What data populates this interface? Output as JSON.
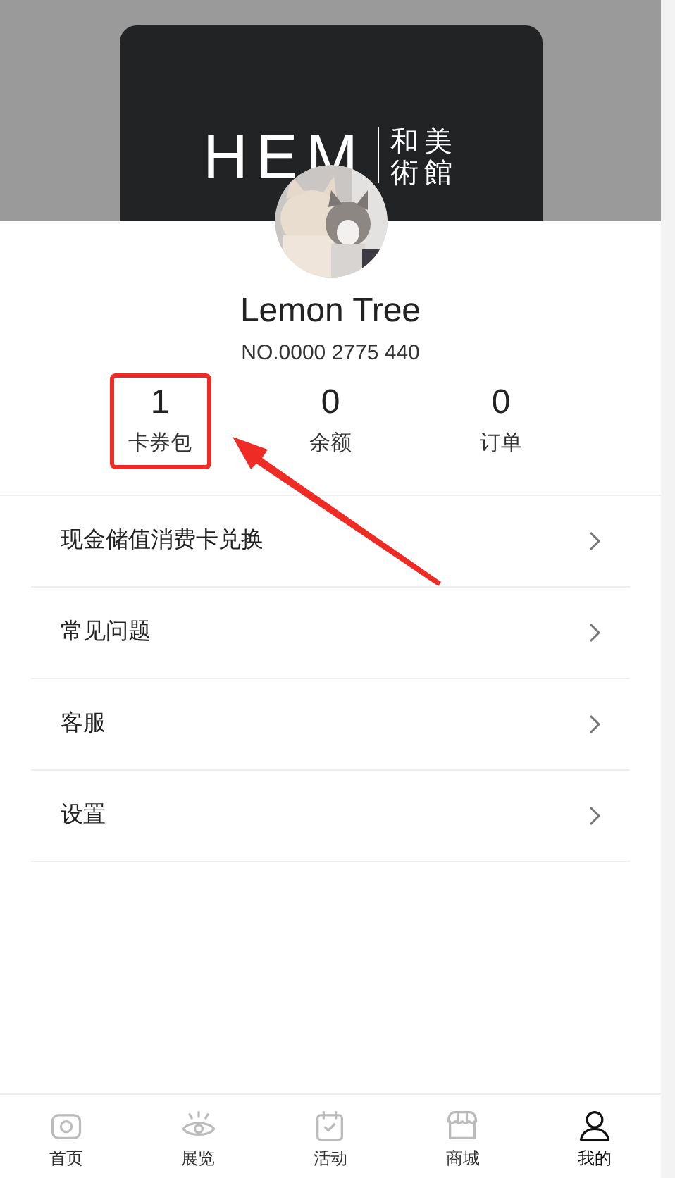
{
  "banner": {
    "logo": "HEM",
    "logo_cn": [
      "和美",
      "術館"
    ]
  },
  "profile": {
    "name": "Lemon Tree",
    "number": "NO.0000 2775 440"
  },
  "stats": [
    {
      "value": "1",
      "label": "卡券包",
      "highlighted": true
    },
    {
      "value": "0",
      "label": "余额",
      "highlighted": false
    },
    {
      "value": "0",
      "label": "订单",
      "highlighted": false
    }
  ],
  "menu": [
    {
      "label": "现金储值消费卡兑换"
    },
    {
      "label": "常见问题"
    },
    {
      "label": "客服"
    },
    {
      "label": "设置"
    }
  ],
  "tabs": [
    {
      "label": "首页",
      "kind": "camera",
      "selected": false
    },
    {
      "label": "展览",
      "kind": "eye",
      "selected": false
    },
    {
      "label": "活动",
      "kind": "calendar",
      "selected": false
    },
    {
      "label": "商城",
      "kind": "shop",
      "selected": false
    },
    {
      "label": "我的",
      "kind": "user",
      "selected": true
    }
  ]
}
